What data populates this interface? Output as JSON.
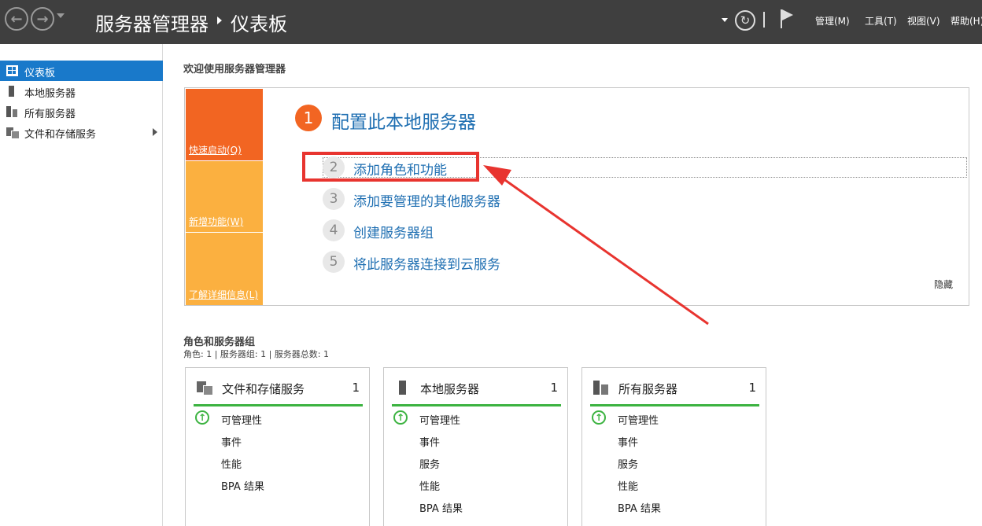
{
  "titlebar": {
    "app_title": "服务器管理器",
    "page_title": "仪表板",
    "menu": {
      "manage": "管理(M)",
      "tools": "工具(T)",
      "view": "视图(V)",
      "help": "帮助(H)"
    }
  },
  "sidebar": {
    "items": [
      {
        "label": "仪表板"
      },
      {
        "label": "本地服务器"
      },
      {
        "label": "所有服务器"
      },
      {
        "label": "文件和存储服务"
      }
    ]
  },
  "welcome": {
    "title": "欢迎使用服务器管理器"
  },
  "quickstart": {
    "tiles": {
      "quick": "快速启动(Q)",
      "new": "新增功能(W)",
      "learn": "了解详细信息(L)"
    },
    "steps": [
      {
        "number": "1",
        "label": "配置此本地服务器"
      },
      {
        "number": "2",
        "label": "添加角色和功能"
      },
      {
        "number": "3",
        "label": "添加要管理的其他服务器"
      },
      {
        "number": "4",
        "label": "创建服务器组"
      },
      {
        "number": "5",
        "label": "将此服务器连接到云服务"
      }
    ],
    "hide": "隐藏"
  },
  "roles": {
    "title": "角色和服务器组",
    "summary": "角色: 1 | 服务器组: 1 | 服务器总数: 1",
    "cards": [
      {
        "title": "文件和存储服务",
        "count": "1",
        "rows": [
          "可管理性",
          "事件",
          "性能",
          "BPA 结果"
        ]
      },
      {
        "title": "本地服务器",
        "count": "1",
        "rows": [
          "可管理性",
          "事件",
          "服务",
          "性能",
          "BPA 结果"
        ]
      },
      {
        "title": "所有服务器",
        "count": "1",
        "rows": [
          "可管理性",
          "事件",
          "服务",
          "性能",
          "BPA 结果"
        ]
      }
    ]
  },
  "colors": {
    "titlebar_bg": "#3f3f3f",
    "selection_blue": "#1979ca",
    "quick_orange": "#f26522",
    "tile_yellow": "#fbb040",
    "link_blue": "#1f6fb2",
    "status_green": "#3cb341",
    "annotation_red": "#e8342f"
  }
}
